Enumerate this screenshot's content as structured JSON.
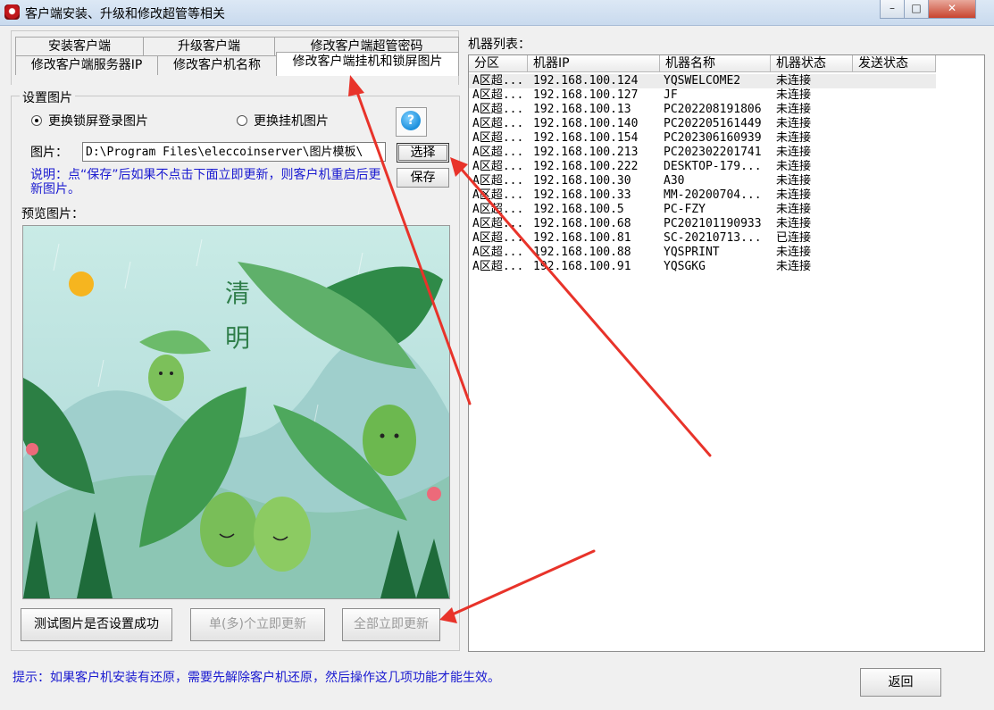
{
  "window": {
    "title": "客户端安装、升级和修改超管等相关"
  },
  "tabs": {
    "row1": [
      "安装客户端",
      "升级客户端",
      "修改客户端超管密码"
    ],
    "row2": [
      "修改客户端服务器IP",
      "修改客户机名称",
      "修改客户端挂机和锁屏图片"
    ]
  },
  "settings": {
    "group_title": "设置图片",
    "radio_lock": "更换锁屏登录图片",
    "radio_idle": "更换挂机图片",
    "selected": "lock",
    "image_label": "图片：",
    "image_path": "D:\\Program Files\\eleccoinserver\\图片模板\\",
    "choose_button": "选择",
    "save_button": "保存",
    "note": "说明：点“保存”后如果不点击下面立即更新，则客户机重启后更新图片。",
    "preview_label": "预览图片：",
    "preview_text": "清明"
  },
  "buttons": {
    "test": "测试图片是否设置成功",
    "single_update": "单(多)个立即更新",
    "all_update": "全部立即更新",
    "back": "返回"
  },
  "hint": "提示：如果客户机安装有还原，需要先解除客户机还原，然后操作这几项功能才能生效。",
  "machine_list": {
    "label": "机器列表：",
    "columns": [
      "分区",
      "机器IP",
      "机器名称",
      "机器状态",
      "发送状态"
    ],
    "rows": [
      {
        "zone": "A区超...",
        "ip": "192.168.100.124",
        "name": "YQSWELCOME2",
        "status": "未连接",
        "send": ""
      },
      {
        "zone": "A区超...",
        "ip": "192.168.100.127",
        "name": "JF",
        "status": "未连接",
        "send": ""
      },
      {
        "zone": "A区超...",
        "ip": "192.168.100.13",
        "name": "PC202208191806",
        "status": "未连接",
        "send": ""
      },
      {
        "zone": "A区超...",
        "ip": "192.168.100.140",
        "name": "PC202205161449",
        "status": "未连接",
        "send": ""
      },
      {
        "zone": "A区超...",
        "ip": "192.168.100.154",
        "name": "PC202306160939",
        "status": "未连接",
        "send": ""
      },
      {
        "zone": "A区超...",
        "ip": "192.168.100.213",
        "name": "PC202302201741",
        "status": "未连接",
        "send": ""
      },
      {
        "zone": "A区超...",
        "ip": "192.168.100.222",
        "name": "DESKTOP-179...",
        "status": "未连接",
        "send": ""
      },
      {
        "zone": "A区超...",
        "ip": "192.168.100.30",
        "name": "A30",
        "status": "未连接",
        "send": ""
      },
      {
        "zone": "A区超...",
        "ip": "192.168.100.33",
        "name": "MM-20200704...",
        "status": "未连接",
        "send": ""
      },
      {
        "zone": "A区超...",
        "ip": "192.168.100.5",
        "name": "PC-FZY",
        "status": "未连接",
        "send": ""
      },
      {
        "zone": "A区超...",
        "ip": "192.168.100.68",
        "name": "PC202101190933",
        "status": "未连接",
        "send": ""
      },
      {
        "zone": "A区超...",
        "ip": "192.168.100.81",
        "name": "SC-20210713...",
        "status": "已连接",
        "send": ""
      },
      {
        "zone": "A区超...",
        "ip": "192.168.100.88",
        "name": "YQSPRINT",
        "status": "未连接",
        "send": ""
      },
      {
        "zone": "A区超...",
        "ip": "192.168.100.91",
        "name": "YQSGKG",
        "status": "未连接",
        "send": ""
      }
    ]
  },
  "colors": {
    "accent_blue": "#1a1ad0",
    "arrow_red": "#e8332a",
    "sky": "#b7dfe0"
  }
}
